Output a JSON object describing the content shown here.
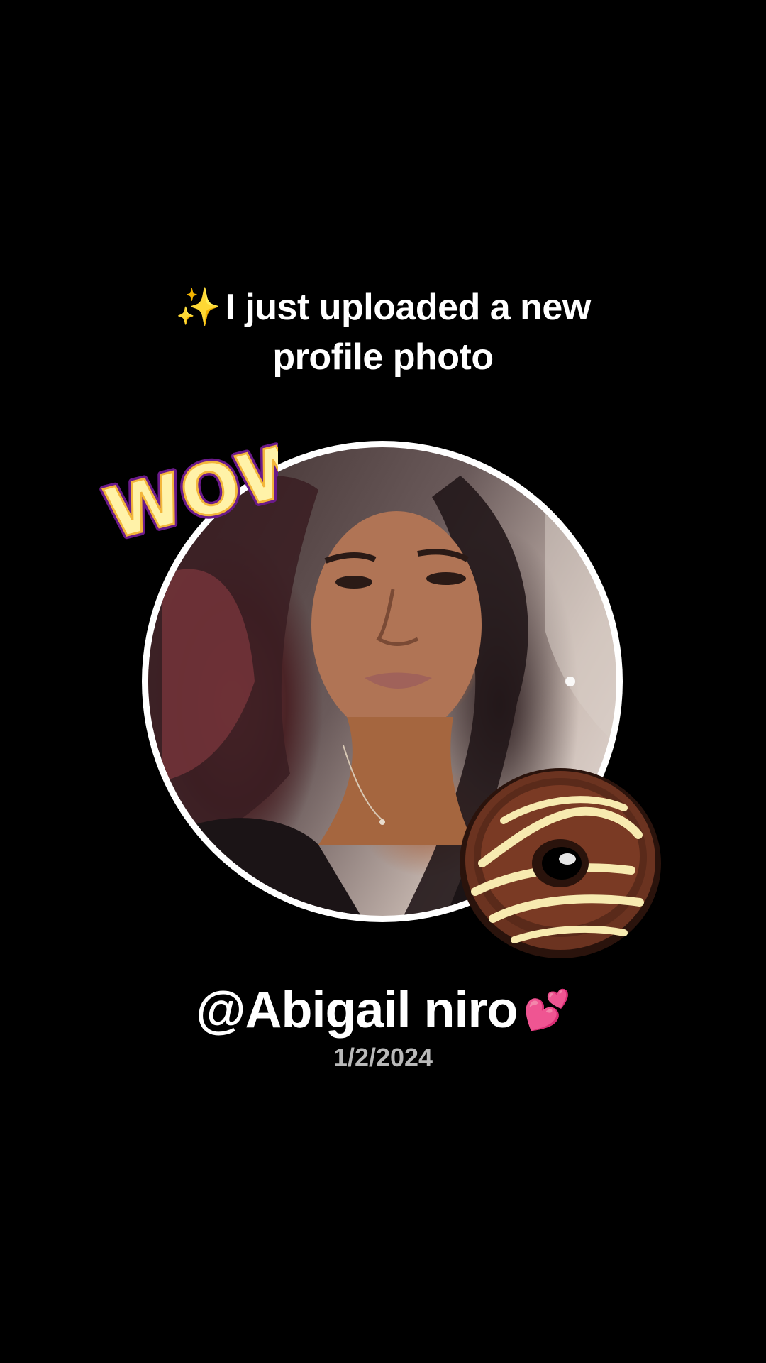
{
  "headline": {
    "sparkle": "✨",
    "line1": "I just uploaded a new",
    "line2": "profile photo"
  },
  "stickers": {
    "wow_text": "WOW!",
    "wow_icon": "wow-burst-sticker",
    "donut_icon": "chocolate-donut-sticker"
  },
  "profile": {
    "username": "@Abigail niro",
    "heart": "💕",
    "date": "1/2/2024"
  },
  "colors": {
    "background": "#000000",
    "text": "#ffffff",
    "date_text": "#b9b9b9",
    "ring": "#ffffff"
  }
}
